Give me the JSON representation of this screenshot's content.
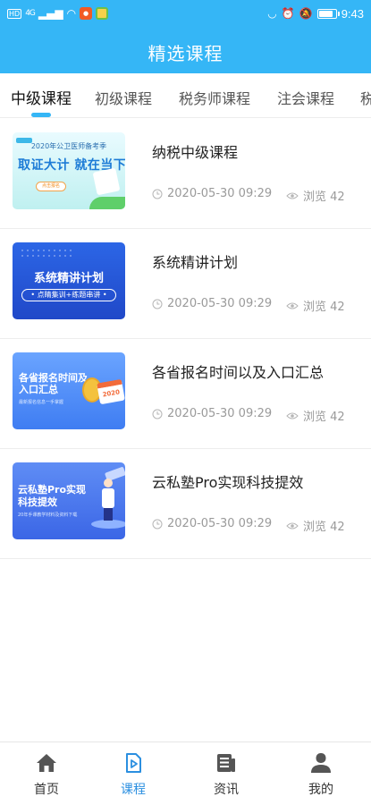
{
  "status_bar": {
    "network_label": "HD",
    "signal_text": "4G",
    "time": "9:43",
    "battery_level": 0.9,
    "colors": {
      "background": "#35b6f6"
    }
  },
  "header": {
    "title": "精选课程"
  },
  "tabs": [
    {
      "label": "中级课程",
      "active": true
    },
    {
      "label": "初级课程",
      "active": false
    },
    {
      "label": "税务师课程",
      "active": false
    },
    {
      "label": "注会课程",
      "active": false
    },
    {
      "label": "税",
      "active": false
    }
  ],
  "courses": [
    {
      "title": "纳税中级课程",
      "time": "2020-05-30 09:29",
      "views": "浏览 42",
      "thumb": {
        "top": "2020年公卫医师备考季",
        "main": "取证大计 就在当下",
        "button": "点击报名"
      }
    },
    {
      "title": "系统精讲计划",
      "time": "2020-05-30 09:29",
      "views": "浏览 42",
      "thumb": {
        "main": "系统精讲计划",
        "sub": "• 点睛集训+练题串讲 •"
      }
    },
    {
      "title": "各省报名时间以及入口汇总",
      "time": "2020-05-30 09:29",
      "views": "浏览 42",
      "thumb": {
        "main": "各省报名时间及入口汇总",
        "sub": "最新报名信息一手掌握",
        "badge": "2020"
      }
    },
    {
      "title": "云私塾Pro实现科技提效",
      "time": "2020-05-30 09:29",
      "views": "浏览 42",
      "thumb": {
        "main": "云私塾Pro实现科技提效",
        "sub": "20年手课教学材料及资料下载"
      }
    }
  ],
  "bottom_nav": [
    {
      "label": "首页",
      "icon": "home-icon",
      "active": false
    },
    {
      "label": "课程",
      "icon": "course-play-icon",
      "active": true
    },
    {
      "label": "资讯",
      "icon": "news-icon",
      "active": false
    },
    {
      "label": "我的",
      "icon": "profile-icon",
      "active": false
    }
  ],
  "colors": {
    "accent": "#35b6f6",
    "nav_active": "#2b8fe0",
    "meta_text": "#9a9a9a"
  }
}
